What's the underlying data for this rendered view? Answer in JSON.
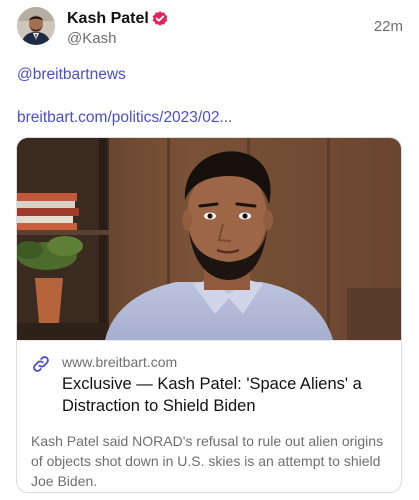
{
  "post": {
    "author_name": "Kash Patel",
    "author_handle": "@Kash",
    "timestamp": "22m",
    "mention": "@breitbartnews",
    "url_text": "breitbart.com/politics/2023/02..."
  },
  "link_card": {
    "domain": "www.breitbart.com",
    "title": "Exclusive — Kash Patel: 'Space Aliens' a Distraction to Shield Biden",
    "description": "Kash Patel said NORAD's refusal to rule out alien origins of objects shot down in U.S. skies is an attempt to shield Joe Biden."
  },
  "icons": {
    "verified": "verified-badge-icon",
    "link": "link-chain-icon"
  },
  "colors": {
    "link": "#4a4fc9",
    "verified_badge": "#e0245e",
    "muted_text": "#6e6e73",
    "card_border": "#dcdce0"
  }
}
